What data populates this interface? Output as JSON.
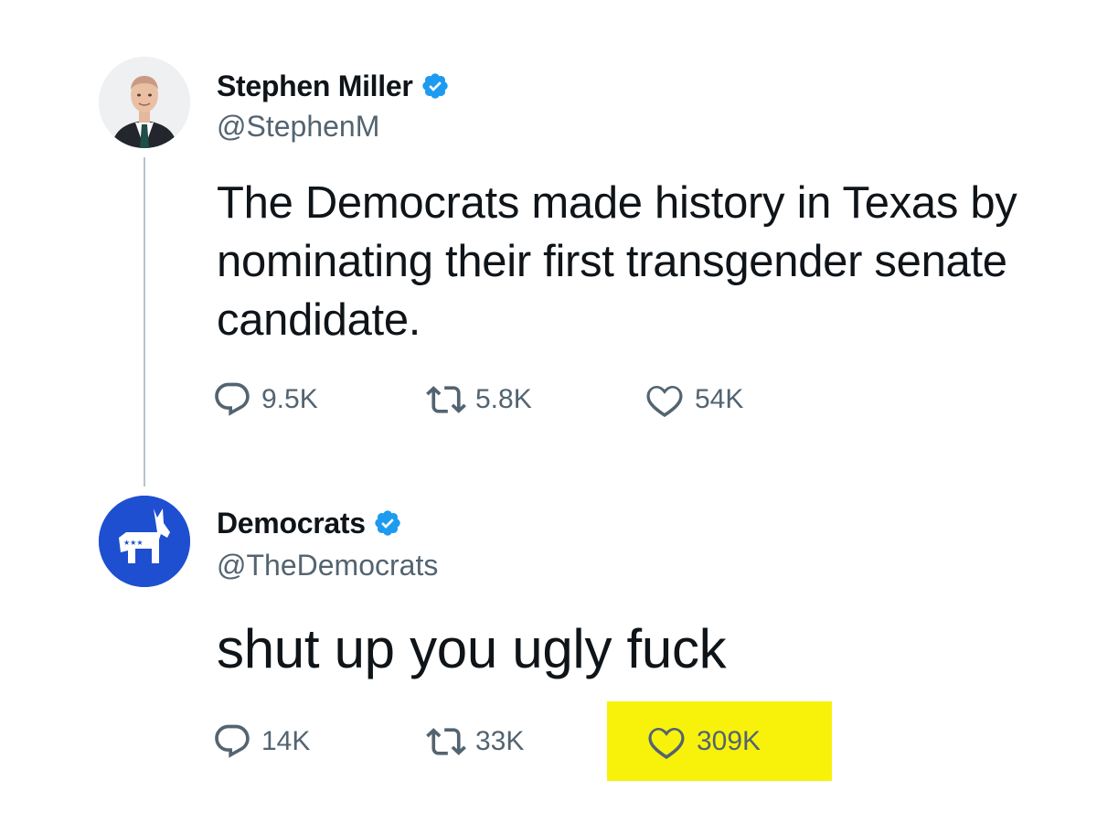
{
  "thread": [
    {
      "display_name": "Stephen Miller",
      "handle": "@StephenM",
      "verified": true,
      "avatar_icon": "person-photo-avatar",
      "text": "The Democrats made history in Texas by nominating their first transgender senate candidate.",
      "stats": {
        "replies": "9.5K",
        "retweets": "5.8K",
        "likes": "54K"
      }
    },
    {
      "display_name": "Democrats",
      "handle": "@TheDemocrats",
      "verified": true,
      "avatar_icon": "donkey-logo-avatar",
      "text": "shut up you ugly fuck",
      "stats": {
        "replies": "14K",
        "retweets": "33K",
        "likes": "309K"
      }
    }
  ],
  "colors": {
    "text": "#0f1419",
    "secondary_text": "#536471",
    "verified_badge": "#1d9bf0",
    "thread_line": "#b9c4cc",
    "democrats_blue": "#1d4fd0",
    "highlight": "#f8f20a"
  },
  "icons": [
    "reply-icon",
    "retweet-icon",
    "like-icon",
    "verified-badge-icon"
  ]
}
